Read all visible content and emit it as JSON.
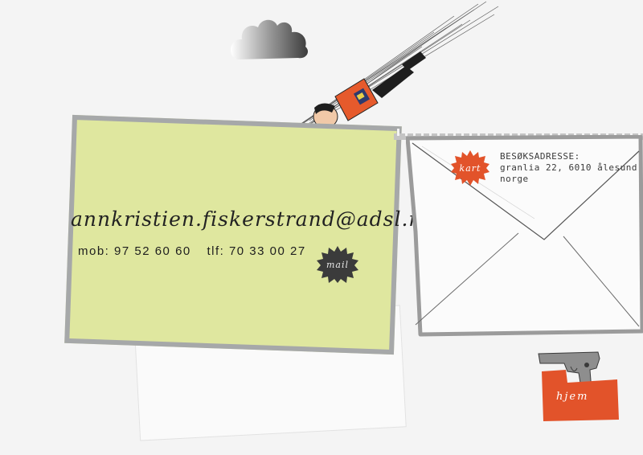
{
  "card": {
    "email": "annkristien.fiskerstrand@adsl.no",
    "mobile": "mob: 97 52 60 60",
    "phone": "tlf: 70 33 00 27"
  },
  "buttons": {
    "mail_label": "mail",
    "kart_label": "kart",
    "hjem_label": "hjem"
  },
  "address": {
    "heading": "BESØKSADRESSE:",
    "street": "granlia 22, 6010 ålesund",
    "country": "norge"
  },
  "icons": {
    "cloud": "cloud-icon",
    "hero": "flying-superhero-illustration",
    "gun": "pistol-icon"
  },
  "colors": {
    "card_bg": "#dfe79f",
    "card_border": "#a6a8a9",
    "accent_orange": "#e2532a",
    "mail_badge": "#3b3b3b"
  }
}
